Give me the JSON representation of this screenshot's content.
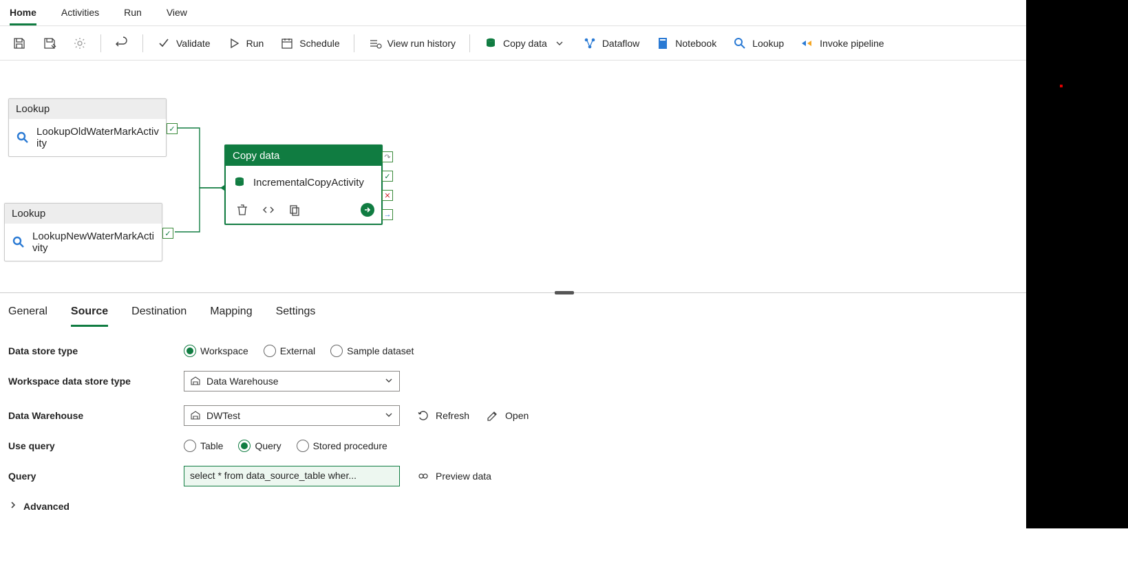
{
  "tabs": {
    "home": "Home",
    "activities": "Activities",
    "run": "Run",
    "view": "View"
  },
  "toolbar": {
    "validate": "Validate",
    "run": "Run",
    "schedule": "Schedule",
    "view_run": "View run history",
    "copy_data": "Copy data",
    "dataflow": "Dataflow",
    "notebook": "Notebook",
    "lookup": "Lookup",
    "invoke": "Invoke pipeline"
  },
  "canvas": {
    "node1": {
      "title": "Lookup",
      "name": "LookupOldWaterMarkActivity"
    },
    "node2": {
      "title": "Lookup",
      "name": "LookupNewWaterMarkActivity"
    },
    "node3": {
      "title": "Copy data",
      "name": "IncrementalCopyActivity"
    }
  },
  "prop_tabs": {
    "general": "General",
    "source": "Source",
    "destination": "Destination",
    "mapping": "Mapping",
    "settings": "Settings"
  },
  "source": {
    "data_store_type_label": "Data store type",
    "ds_opt_workspace": "Workspace",
    "ds_opt_external": "External",
    "ds_opt_sample": "Sample dataset",
    "workspace_type_label": "Workspace data store type",
    "workspace_type_value": "Data Warehouse",
    "warehouse_label": "Data Warehouse",
    "warehouse_value": "DWTest",
    "refresh": "Refresh",
    "open": "Open",
    "use_query_label": "Use query",
    "uq_table": "Table",
    "uq_query": "Query",
    "uq_sp": "Stored procedure",
    "query_label": "Query",
    "query_value": "select * from data_source_table wher...",
    "preview": "Preview data",
    "advanced": "Advanced"
  }
}
